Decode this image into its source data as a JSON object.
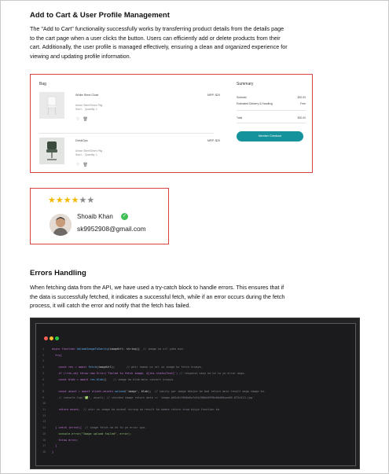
{
  "section1": {
    "heading": "Add to Cart & User Profile Management",
    "para_lines": [
      "The \"Add to Cart\" functionality successfully works by transferring product details from the details page",
      "to the cart page when a user clicks the button. Users can efficiently add or delete products from their",
      "cart. Additionally, the user profile is managed effectively, ensuring a clean and organized experience for",
      "viewing and updating profile information."
    ]
  },
  "cart": {
    "bag_title": "Bag",
    "summary_title": "Summary",
    "items": [
      {
        "name": "White Steel Chair",
        "price": "MRP: $20",
        "seller": "Almon Steel/Omen Pkg",
        "size": "Size L",
        "quantity": "Quantity: 1"
      },
      {
        "name": "DeskOps",
        "price": "MRP: $20",
        "seller": "Almon Steel/Omen Pkg",
        "size": "Size L",
        "quantity": "Quantity: 1"
      }
    ],
    "summary": {
      "subtotal_label": "Subtotal",
      "subtotal_value": "$20.00",
      "delivery_label": "Estimated Delivery & Handling",
      "delivery_value": "Free",
      "total_label": "Total",
      "total_value": "$20.00"
    },
    "checkout_label": "Member Checkout"
  },
  "profile": {
    "stars_filled": 4,
    "stars_total": 6,
    "name": "Shoaib Khan",
    "email": "sk9952908@gmail.com"
  },
  "section2": {
    "heading": "Errors Handling",
    "para_lines": [
      "When fetching data from the API, we have used a try-catch block to handle errors. This ensures that if",
      "the data is successfully fetched, it indicates a successful fetch, while if an error occurs during the fetch",
      "process, it will catch the error and notify that the fetch has failed."
    ]
  },
  "code": {
    "line_numbers": [
      "1",
      "2",
      "3",
      "4",
      "5",
      "6",
      "7",
      "8",
      "9",
      "10",
      "11",
      "12",
      "13",
      "14",
      "15",
      "16",
      "17",
      "18"
    ],
    "lines": [
      {
        "a": "async function ",
        "b": "UploadImageToSanity",
        "c": "(imageUrl: string){  ",
        "d": "// image ka url yaha aya."
      },
      {
        "a": "  try{",
        "b": "",
        "c": "",
        "d": ""
      },
      {
        "a": "",
        "b": "",
        "c": "",
        "d": ""
      },
      {
        "a": "    const res = await ",
        "b": "fetch",
        "c": "(imageUrl);       ",
        "d": "// phir hamne us url se image ko fetch krwaya."
      },
      {
        "a": "    if (!res.ok) throw new Error(`Failed to fetch image, ${res.statusText}`) ",
        "b": "",
        "c": "",
        "d": "// response okay ka ho to ye error aega."
      },
      {
        "a": "    const blob = await ",
        "b": "res.blob",
        "c": "()    ",
        "d": "// image ko blob mein convert krwaya."
      },
      {
        "a": "",
        "b": "",
        "c": "",
        "d": ""
      },
      {
        "a": "    const asset = await client.assets.",
        "b": "upload",
        "c": "('image', blob);  ",
        "d": "// sanity par image bhejne ke bad return mein result aega image ka."
      },
      {
        "a": "    // console.log(\"✅\", asset); ",
        "b": "",
        "c": "",
        "d": "// checked image return data => 'image-b03c0c96b8a5afd5e2080e0998e0bd06aaa05-875x513-jpg'"
      },
      {
        "a": "",
        "b": "",
        "c": "",
        "d": ""
      },
      {
        "a": "    return asset;  ",
        "b": "",
        "c": "",
        "d": "// phir us image ka normal string ko result ko hamne return krwa diyya function ko."
      },
      {
        "a": "",
        "b": "",
        "c": "",
        "d": ""
      },
      {
        "a": "",
        "b": "",
        "c": "",
        "d": ""
      },
      {
        "a": "  } catch (error){  ",
        "b": "",
        "c": "",
        "d": "// image fetch na ho to ye error aye."
      },
      {
        "a": "    console.error(\"Image upload failed\", error);",
        "b": "",
        "c": "",
        "d": ""
      },
      {
        "a": "    throw error;",
        "b": "",
        "c": "",
        "d": ""
      },
      {
        "a": "  }",
        "b": "",
        "c": "",
        "d": ""
      },
      {
        "a": "}",
        "b": "",
        "c": "",
        "d": ""
      }
    ]
  },
  "colors": {
    "frame_red": "#d94343",
    "checkout_teal": "#14939c",
    "star_gold": "#f5b800",
    "dot_red": "#ff5f57",
    "dot_yellow": "#febc2e",
    "dot_green": "#28c840"
  }
}
